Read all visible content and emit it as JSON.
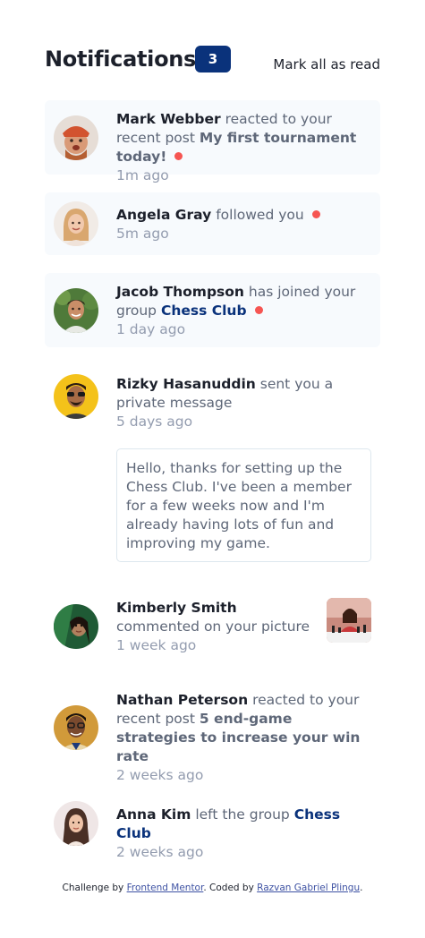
{
  "header": {
    "title": "Notifications",
    "unread_count": "3",
    "mark_all": "Mark all as read"
  },
  "notifications": [
    {
      "name": "Mark Webber",
      "action": "reacted to your recent post",
      "target": "My first tournament today!",
      "time": "1m ago",
      "unread": true
    },
    {
      "name": "Angela Gray",
      "action": "followed you",
      "time": "5m ago",
      "unread": true
    },
    {
      "name": "Jacob Thompson",
      "action": "has joined your group",
      "target": "Chess Club",
      "time": "1 day ago",
      "unread": true
    },
    {
      "name": "Rizky Hasanuddin",
      "action": "sent you a private message",
      "time": "5 days ago",
      "unread": false,
      "message": "Hello, thanks for setting up the Chess Club. I've been a member for a few weeks now and I'm already having lots of fun and improving my game."
    },
    {
      "name": "Kimberly Smith",
      "action": "commented on your picture",
      "time": "1 week ago",
      "unread": false
    },
    {
      "name": "Nathan Peterson",
      "action": "reacted to your recent post",
      "target": "5 end-game strategies to increase your win rate",
      "time": "2 weeks ago",
      "unread": false
    },
    {
      "name": "Anna Kim",
      "action": "left the group",
      "target": "Chess Club",
      "time": "2 weeks ago",
      "unread": false
    }
  ],
  "footer": {
    "prefix": "Challenge by",
    "link1": "Frontend Mentor",
    "middle": ". Coded by",
    "link2": "Razvan Gabriel Plingu",
    "suffix": "."
  },
  "colors": {
    "unread_bg": "#f7fafd",
    "badge": "#0a327b",
    "dot": "#f65552",
    "group_link": "#0a327b",
    "muted": "#939caf"
  }
}
